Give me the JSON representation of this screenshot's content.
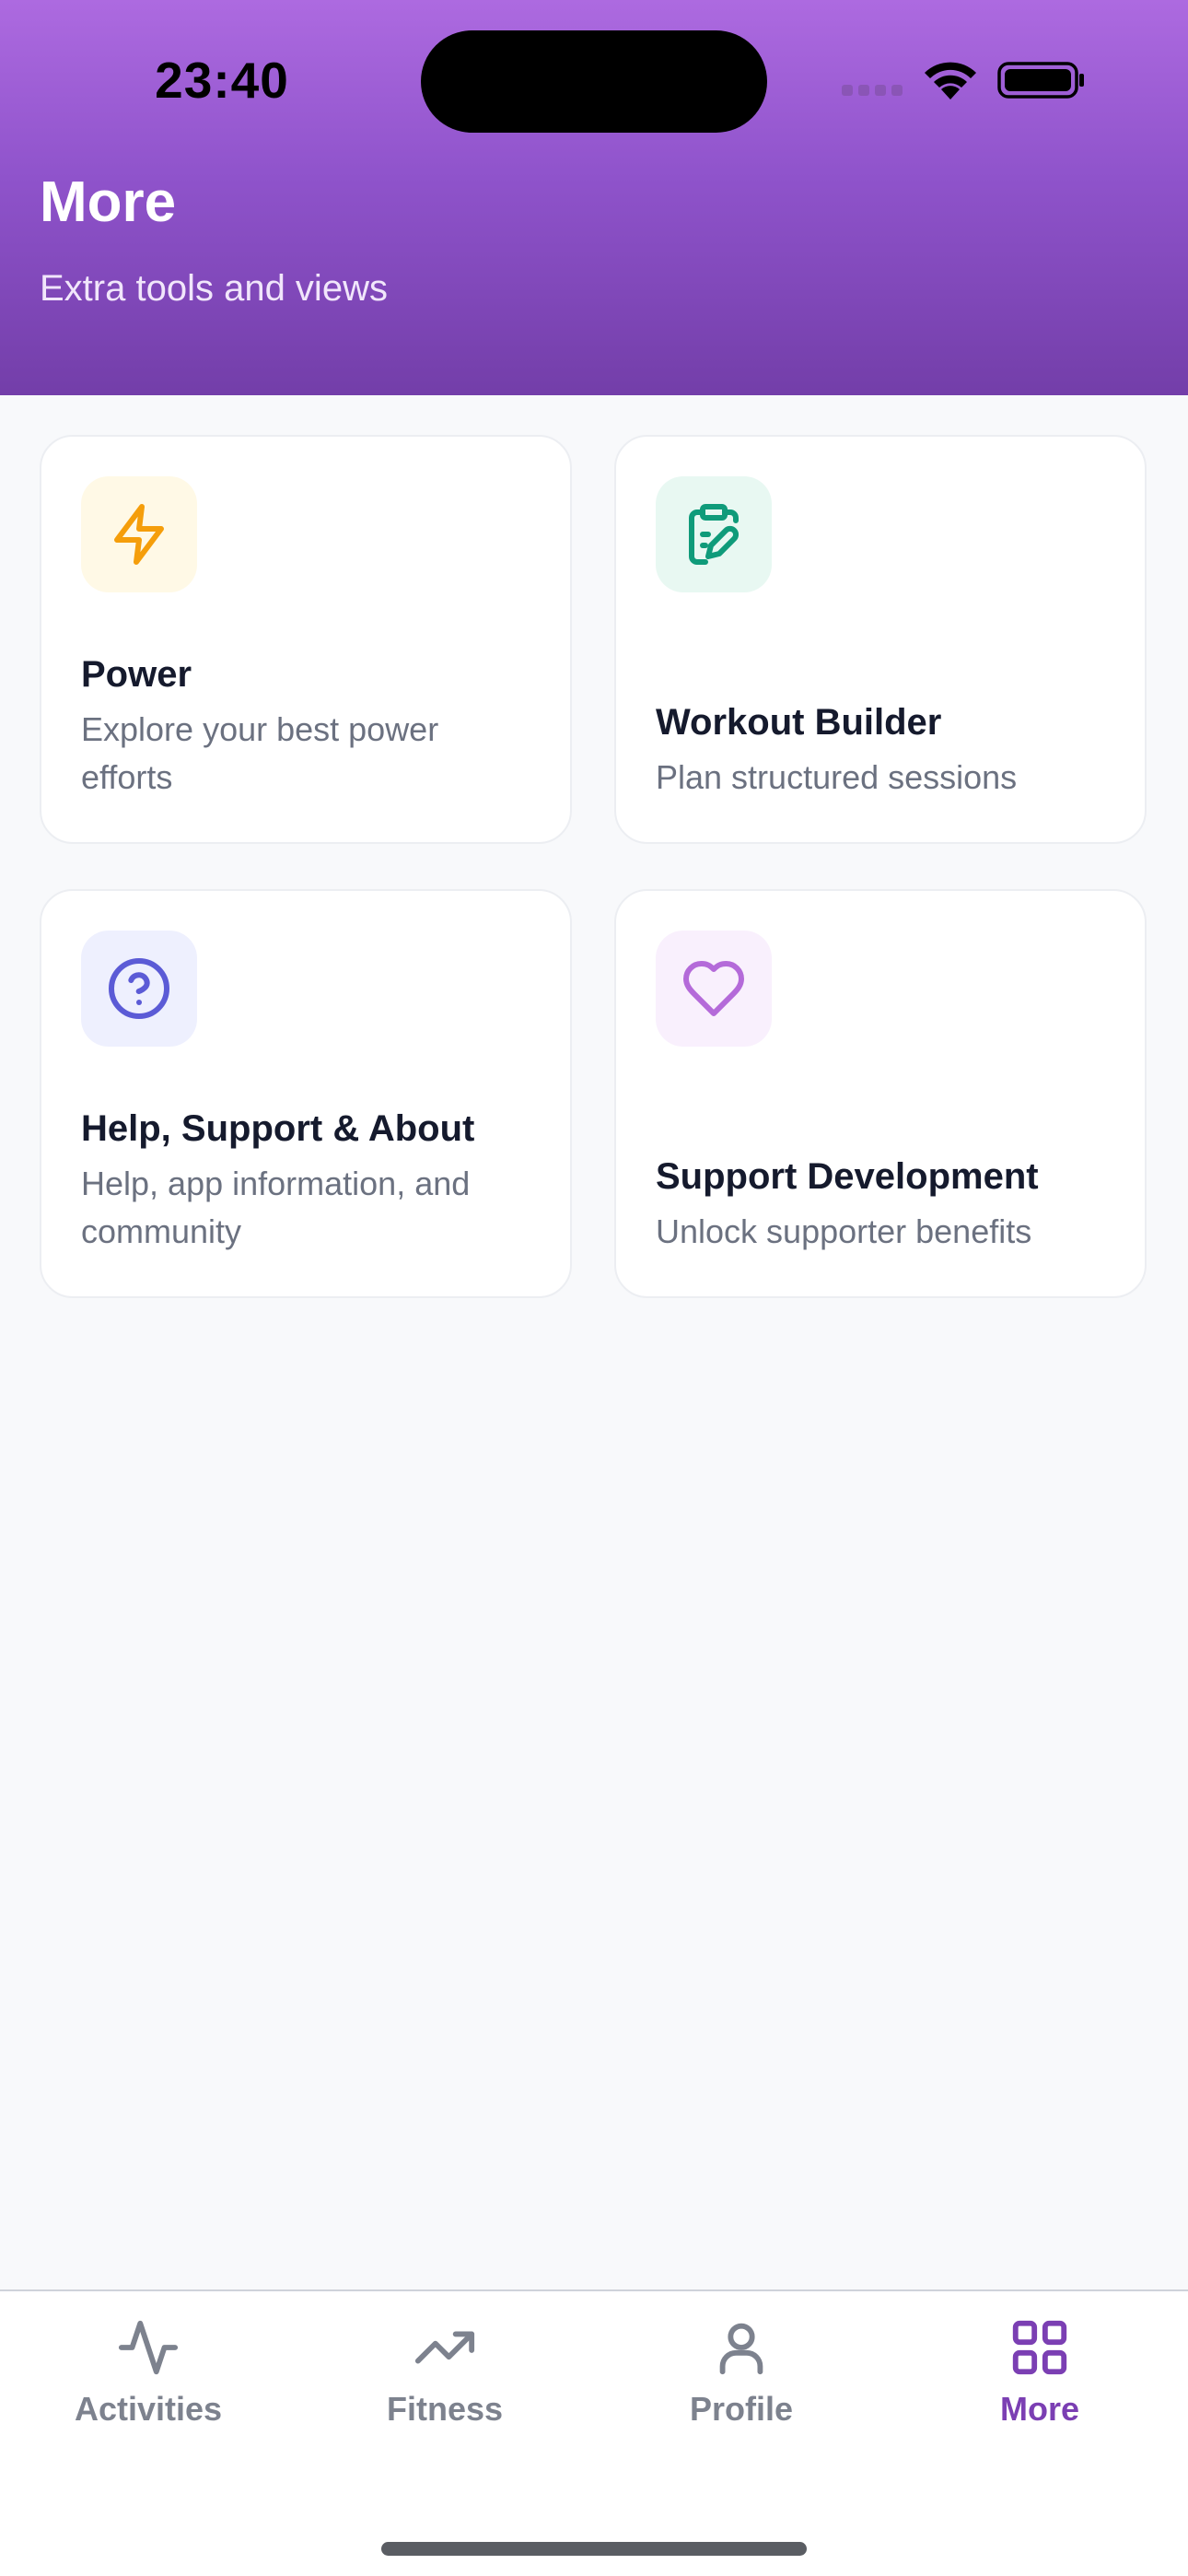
{
  "status_bar": {
    "time": "23:40"
  },
  "header": {
    "title": "More",
    "subtitle": "Extra tools and views"
  },
  "cards": [
    {
      "title": "Power",
      "description": "Explore your best power efforts",
      "icon": "lightning-icon",
      "icon_color": "#f59e0b",
      "icon_bg": "#fff9e6"
    },
    {
      "title": "Workout Builder",
      "description": "Plan structured sessions",
      "icon": "clipboard-edit-icon",
      "icon_color": "#0f9b7a",
      "icon_bg": "#e8f8f2"
    },
    {
      "title": "Help, Support & About",
      "description": "Help, app information, and community",
      "icon": "help-circle-icon",
      "icon_color": "#5b5bd6",
      "icon_bg": "#eef0fe"
    },
    {
      "title": "Support Development",
      "description": "Unlock supporter benefits",
      "icon": "heart-icon",
      "icon_color": "#b46ad9",
      "icon_bg": "#f9f0fd"
    }
  ],
  "tab_bar": {
    "tabs": [
      {
        "label": "Activities",
        "icon": "activity-pulse-icon",
        "active": false
      },
      {
        "label": "Fitness",
        "icon": "trending-up-icon",
        "active": false
      },
      {
        "label": "Profile",
        "icon": "user-icon",
        "active": false
      },
      {
        "label": "More",
        "icon": "grid-icon",
        "active": true
      }
    ],
    "inactive_color": "#7d828e",
    "active_color": "#7b3fb3"
  },
  "colors": {
    "header_gradient_top": "#ad6ae0",
    "header_gradient_bottom": "#733ea9",
    "background": "#f8f9fb"
  }
}
